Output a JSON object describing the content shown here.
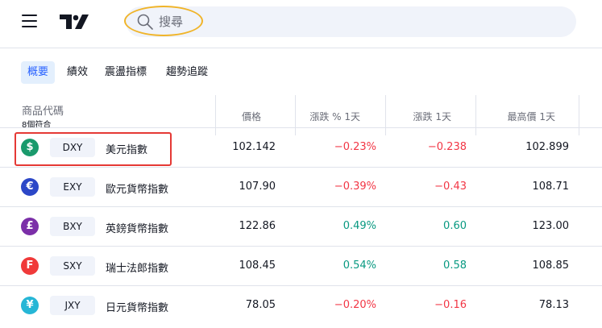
{
  "header": {
    "search_placeholder": "搜尋"
  },
  "tabs": [
    {
      "label": "概要",
      "active": true
    },
    {
      "label": "績效",
      "active": false
    },
    {
      "label": "震盪指標",
      "active": false
    },
    {
      "label": "趨勢追蹤",
      "active": false
    }
  ],
  "table": {
    "symbol_header": "商品代碼",
    "count_label": "8個符合",
    "columns": [
      "價格",
      "漲跌 % 1天",
      "漲跌 1天",
      "最高價 1天"
    ],
    "rows": [
      {
        "icon": "$",
        "icon_color": "#1a9a6c",
        "ticker": "DXY",
        "name": "美元指數",
        "price": "102.142",
        "change_pct": "−0.23%",
        "change": "−0.238",
        "high": "102.899",
        "dir": "neg"
      },
      {
        "icon": "€",
        "icon_color": "#2c47c7",
        "ticker": "EXY",
        "name": "歐元貨幣指數",
        "price": "107.90",
        "change_pct": "−0.39%",
        "change": "−0.43",
        "high": "108.71",
        "dir": "neg"
      },
      {
        "icon": "£",
        "icon_color": "#7b2fa8",
        "ticker": "BXY",
        "name": "英鎊貨幣指數",
        "price": "122.86",
        "change_pct": "0.49%",
        "change": "0.60",
        "high": "123.00",
        "dir": "pos"
      },
      {
        "icon": "F",
        "icon_color": "#f03a3a",
        "ticker": "SXY",
        "name": "瑞士法郎指數",
        "price": "108.45",
        "change_pct": "0.54%",
        "change": "0.58",
        "high": "108.85",
        "dir": "pos"
      },
      {
        "icon": "¥",
        "icon_color": "#26b6d6",
        "ticker": "JXY",
        "name": "日元貨幣指數",
        "price": "78.05",
        "change_pct": "−0.20%",
        "change": "−0.16",
        "high": "78.13",
        "dir": "neg"
      }
    ]
  },
  "colors": {
    "accent": "#2962ff",
    "negative": "#f23645",
    "positive": "#089981",
    "highlight_box": "#e53935",
    "search_highlight": "#f0b429"
  }
}
